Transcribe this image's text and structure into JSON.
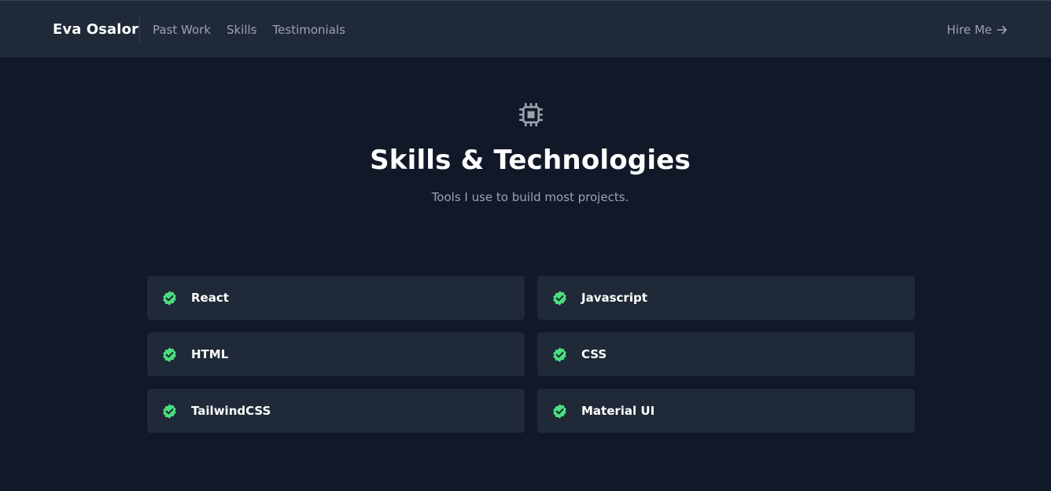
{
  "nav": {
    "brand": "Eva Osalor",
    "links": [
      "Past Work",
      "Skills",
      "Testimonials"
    ],
    "cta_label": "Hire Me"
  },
  "section": {
    "icon": "chip-icon",
    "title": "Skills & Technologies",
    "subtitle": "Tools I use to build most projects."
  },
  "skills": [
    "React",
    "Javascript",
    "HTML",
    "CSS",
    "TailwindCSS",
    "Material UI"
  ],
  "colors": {
    "background": "#111827",
    "surface": "#1f2937",
    "text": "#ffffff",
    "muted": "#9ca3af",
    "accent": "#4ade80"
  }
}
